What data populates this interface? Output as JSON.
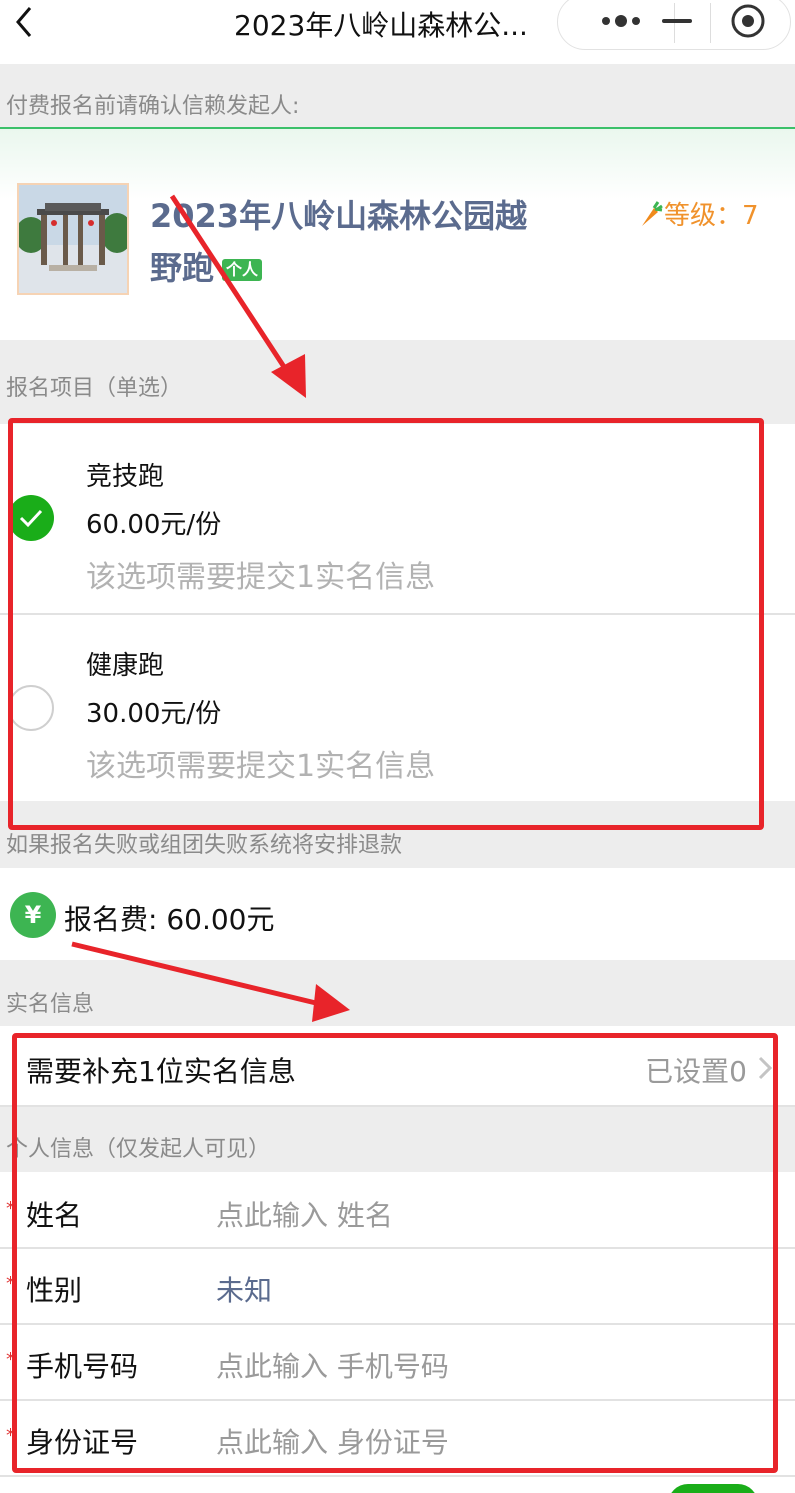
{
  "nav": {
    "title": "2023年八岭山森林公..."
  },
  "notice": "付费报名前请确认信赖发起人:",
  "event": {
    "title": "2023年八岭山森林公园越野跑",
    "badge": "个人",
    "level": "等级：7"
  },
  "options_header": "报名项目（单选）",
  "options": [
    {
      "name": "竞技跑",
      "price": "60.00元/份",
      "note": "该选项需要提交1实名信息",
      "selected": true
    },
    {
      "name": "健康跑",
      "price": "30.00元/份",
      "note": "该选项需要提交1实名信息",
      "selected": false
    }
  ],
  "refund_note": "如果报名失败或组团失败系统将安排退款",
  "fee": {
    "symbol": "¥",
    "text": "报名费: 60.00元"
  },
  "realname_header": "实名信息",
  "realname_row": {
    "label": "需要补充1位实名信息",
    "status": "已设置0"
  },
  "personal_header": "个人信息（仅发起人可见）",
  "fields": [
    {
      "label": "姓名",
      "value": "点此输入  姓名"
    },
    {
      "label": "性别",
      "value": "未知"
    },
    {
      "label": "手机号码",
      "value": "点此输入  手机号码"
    },
    {
      "label": "身份证号",
      "value": "点此输入  身份证号"
    }
  ],
  "colors": {
    "accent_green": "#1aad19",
    "annotation_red": "#e8242a",
    "level_orange": "#f0922c",
    "title_blue": "#5b6b8e"
  }
}
